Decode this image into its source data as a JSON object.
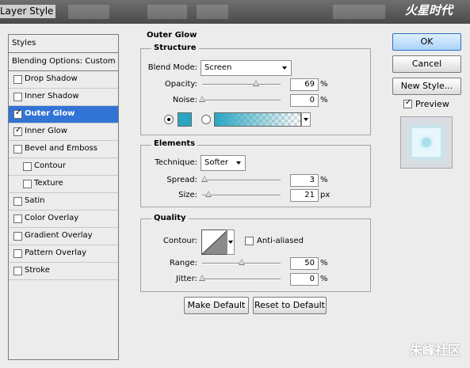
{
  "window": {
    "title": "Layer Style",
    "watermark_top": "火星时代"
  },
  "styles_list": {
    "header": "Styles",
    "blending_options": "Blending Options: Custom",
    "items": [
      {
        "label": "Drop Shadow",
        "checked": false,
        "selected": false,
        "indent": false
      },
      {
        "label": "Inner Shadow",
        "checked": false,
        "selected": false,
        "indent": false
      },
      {
        "label": "Outer Glow",
        "checked": true,
        "selected": true,
        "indent": false
      },
      {
        "label": "Inner Glow",
        "checked": true,
        "selected": false,
        "indent": false
      },
      {
        "label": "Bevel and Emboss",
        "checked": false,
        "selected": false,
        "indent": false
      },
      {
        "label": "Contour",
        "checked": false,
        "selected": false,
        "indent": true
      },
      {
        "label": "Texture",
        "checked": false,
        "selected": false,
        "indent": true
      },
      {
        "label": "Satin",
        "checked": false,
        "selected": false,
        "indent": false
      },
      {
        "label": "Color Overlay",
        "checked": false,
        "selected": false,
        "indent": false
      },
      {
        "label": "Gradient Overlay",
        "checked": false,
        "selected": false,
        "indent": false
      },
      {
        "label": "Pattern Overlay",
        "checked": false,
        "selected": false,
        "indent": false
      },
      {
        "label": "Stroke",
        "checked": false,
        "selected": false,
        "indent": false
      }
    ]
  },
  "outer_glow": {
    "title": "Outer Glow",
    "structure": {
      "title": "Structure",
      "blend_mode_label": "Blend Mode:",
      "blend_mode_value": "Screen",
      "opacity_label": "Opacity:",
      "opacity_value": "69",
      "opacity_fraction": 0.69,
      "opacity_unit": "%",
      "noise_label": "Noise:",
      "noise_value": "0",
      "noise_fraction": 0,
      "noise_unit": "%",
      "glow_color": "#2aa6c2",
      "color_option_selected": "solid"
    },
    "elements": {
      "title": "Elements",
      "technique_label": "Technique:",
      "technique_value": "Softer",
      "spread_label": "Spread:",
      "spread_value": "3",
      "spread_fraction": 0.03,
      "spread_unit": "%",
      "size_label": "Size:",
      "size_value": "21",
      "size_fraction": 0.08,
      "size_unit": "px"
    },
    "quality": {
      "title": "Quality",
      "contour_label": "Contour:",
      "anti_aliased_label": "Anti-aliased",
      "anti_aliased_checked": false,
      "range_label": "Range:",
      "range_value": "50",
      "range_fraction": 0.5,
      "range_unit": "%",
      "jitter_label": "Jitter:",
      "jitter_value": "0",
      "jitter_fraction": 0,
      "jitter_unit": "%"
    },
    "make_default": "Make Default",
    "reset_to_default": "Reset to Default"
  },
  "actions": {
    "ok": "OK",
    "cancel": "Cancel",
    "new_style": "New Style...",
    "preview_label": "Preview",
    "preview_checked": true
  },
  "footer_watermark": "朱峰社区"
}
